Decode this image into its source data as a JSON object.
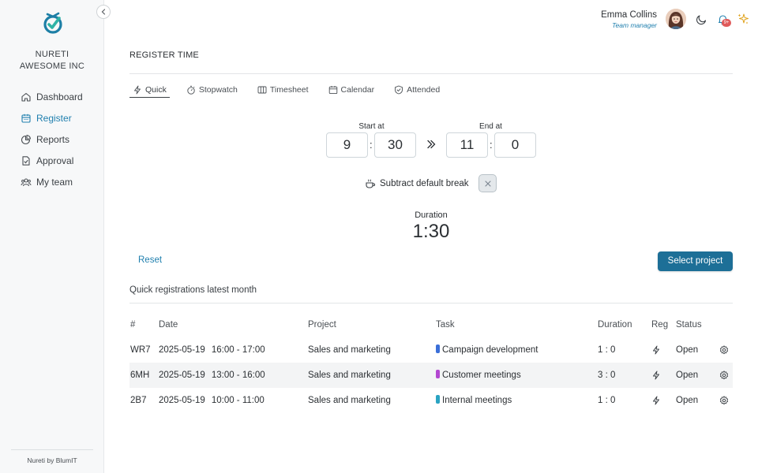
{
  "sidebar": {
    "org_name": "NURETI",
    "org_company": "AWESOME INC",
    "items": [
      {
        "label": "Dashboard",
        "icon": "home-icon",
        "active": false
      },
      {
        "label": "Register",
        "icon": "calendar-icon",
        "active": true
      },
      {
        "label": "Reports",
        "icon": "pie-chart-icon",
        "active": false
      },
      {
        "label": "Approval",
        "icon": "document-check-icon",
        "active": false
      },
      {
        "label": "My team",
        "icon": "team-icon",
        "active": false
      }
    ],
    "footer": "Nureti by BlumIT"
  },
  "header": {
    "user_name": "Emma Collins",
    "user_role": "Team manager",
    "notification_badge": "9+"
  },
  "page": {
    "title": "REGISTER TIME",
    "tabs": [
      {
        "label": "Quick",
        "icon": "lightning-icon",
        "active": true
      },
      {
        "label": "Stopwatch",
        "icon": "stopwatch-icon",
        "active": false
      },
      {
        "label": "Timesheet",
        "icon": "timesheet-icon",
        "active": false
      },
      {
        "label": "Calendar",
        "icon": "calendar-icon",
        "active": false
      },
      {
        "label": "Attended",
        "icon": "shield-check-icon",
        "active": false
      }
    ],
    "start_label": "Start at",
    "start_hour": "9",
    "start_minute": "30",
    "end_label": "End at",
    "end_hour": "11",
    "end_minute": "0",
    "colon": ":",
    "break_label": "Subtract default break",
    "duration_label": "Duration",
    "duration_value": "1:30",
    "reset_label": "Reset",
    "select_project_label": "Select project",
    "section_title": "Quick registrations latest month"
  },
  "table": {
    "headers": {
      "id": "#",
      "date": "Date",
      "project": "Project",
      "task": "Task",
      "duration": "Duration",
      "reg": "Reg",
      "status": "Status"
    },
    "rows": [
      {
        "id": "WR7",
        "date": "2025-05-19",
        "time": "16:00 - 17:00",
        "project": "Sales and marketing",
        "task": "Campaign development",
        "task_color": "#3b6fd8",
        "duration": "1 : 0",
        "status": "Open"
      },
      {
        "id": "6MH",
        "date": "2025-05-19",
        "time": "13:00 - 16:00",
        "project": "Sales and marketing",
        "task": "Customer meetings",
        "task_color": "#b347d1",
        "duration": "3 : 0",
        "status": "Open"
      },
      {
        "id": "2B7",
        "date": "2025-05-19",
        "time": "10:00 - 11:00",
        "project": "Sales and marketing",
        "task": "Internal meetings",
        "task_color": "#2aa3c2",
        "duration": "1 : 0",
        "status": "Open"
      }
    ]
  },
  "colors": {
    "accent": "#1f7fae",
    "primary_button": "#1d6f97",
    "badge": "#e05a5a"
  }
}
